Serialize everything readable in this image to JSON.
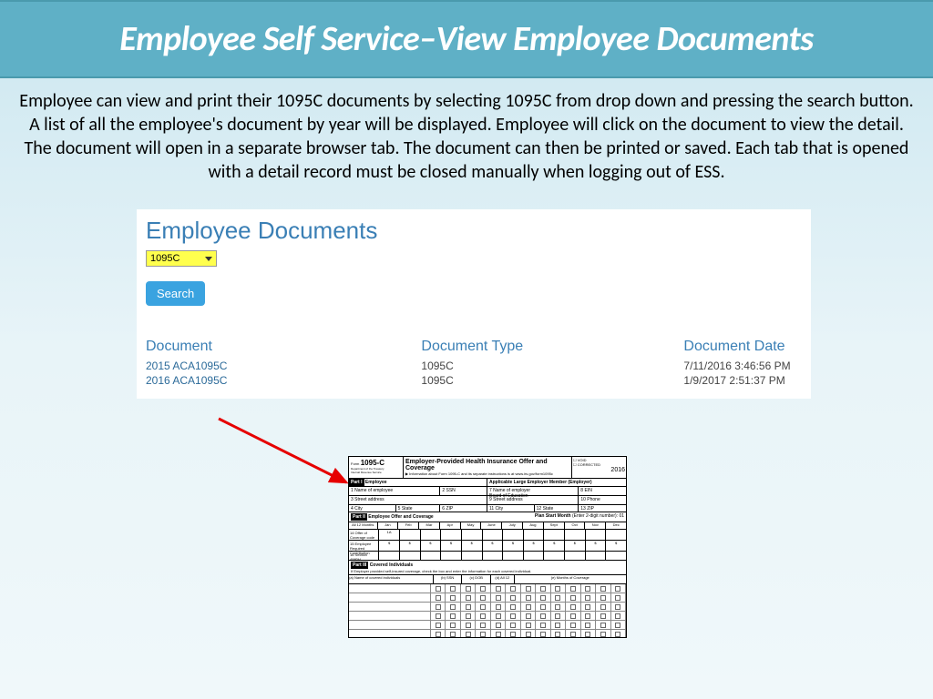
{
  "title": "Employee Self Service–View Employee Documents",
  "description": "Employee can view and print their 1095C documents by selecting 1095C from drop down and pressing the search button.  A list of all the employee's document by year will be displayed.  Employee will click on the document to view the detail.  The document will open in a separate browser tab.   The document can then be printed or saved.  Each tab that is opened with a detail record must be closed manually when logging out of ESS.",
  "panel": {
    "heading": "Employee Documents",
    "dropdown_value": "1095C",
    "search_label": "Search",
    "columns": {
      "document": "Document",
      "type": "Document Type",
      "date": "Document Date"
    },
    "rows": [
      {
        "doc": "2015 ACA1095C",
        "type": "1095C",
        "date": "7/11/2016 3:46:56 PM"
      },
      {
        "doc": "2016 ACA1095C",
        "type": "1095C",
        "date": "1/9/2017 2:51:37 PM"
      }
    ]
  },
  "form": {
    "code": "1095-C",
    "title": "Employer-Provided Health Insurance Offer and Coverage",
    "void": "VOID",
    "corrected": "CORRECTED",
    "year": "2016",
    "part1": "Part I",
    "employee": "Employee",
    "employer_heading": "Applicable Large Employer Member (Employer)",
    "board": "Board of Education",
    "part2": "Part II",
    "offer": "Employee Offer and Coverage",
    "plan_start": "Plan Start Month",
    "plan_code": "01",
    "months": [
      "All 12 Months",
      "Jan",
      "Feb",
      "Mar",
      "Apr",
      "May",
      "June",
      "July",
      "Aug",
      "Sept",
      "Oct",
      "Nov",
      "Dec"
    ],
    "line14": "1A",
    "part3": "Part III",
    "covered": "Covered Individuals"
  }
}
